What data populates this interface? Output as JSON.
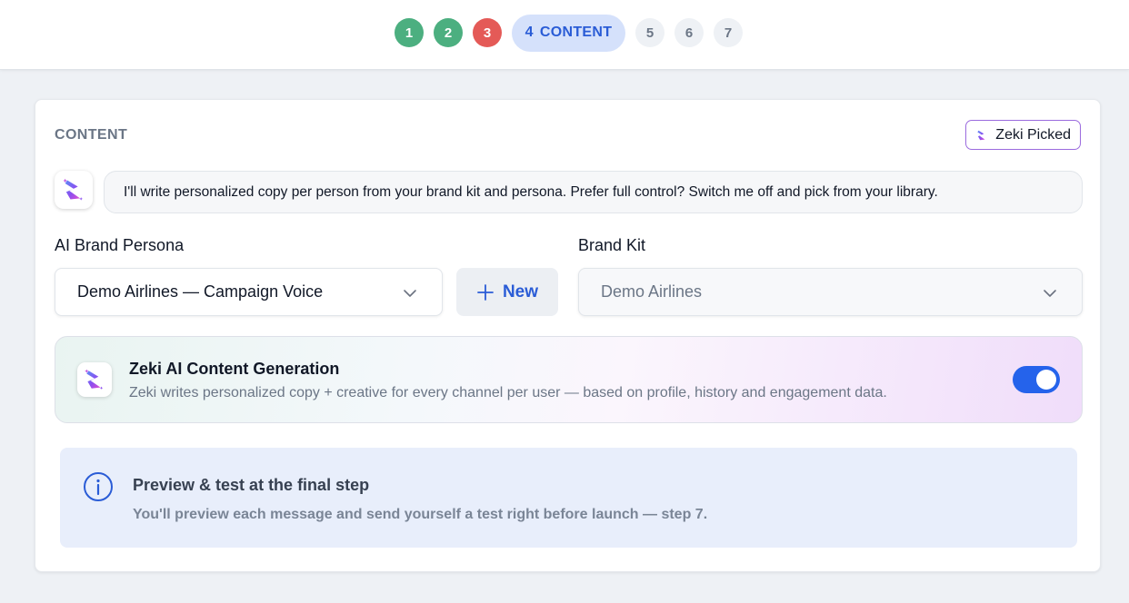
{
  "stepper": {
    "steps": [
      {
        "number": "1",
        "state": "done"
      },
      {
        "number": "2",
        "state": "done"
      },
      {
        "number": "3",
        "state": "error"
      },
      {
        "number": "4",
        "label": "CONTENT",
        "state": "active"
      },
      {
        "number": "5",
        "state": "future"
      },
      {
        "number": "6",
        "state": "future"
      },
      {
        "number": "7",
        "state": "future"
      }
    ]
  },
  "content": {
    "section_title": "CONTENT",
    "badge_label": "Zeki Picked",
    "assistant_message": "I'll write personalized copy per person from your brand kit and persona. Prefer full control? Switch me off and pick from your library.",
    "persona": {
      "label": "AI Brand Persona",
      "selected": "Demo Airlines — Campaign Voice",
      "new_button": "New"
    },
    "brand_kit": {
      "label": "Brand Kit",
      "selected": "Demo Airlines"
    },
    "generation": {
      "title": "Zeki AI Content Generation",
      "description": "Zeki writes personalized copy + creative for every channel per user — based on profile, history and engagement data.",
      "enabled": true
    },
    "info": {
      "title": "Preview & test at the final step",
      "description": "You'll preview each message and send yourself a test right before launch — step 7."
    }
  },
  "colors": {
    "accent": "#2563eb",
    "step_done": "#4caf80",
    "step_error": "#e45a57",
    "active_step_bg": "#d5e1fb",
    "badge_border": "#9b6bde"
  },
  "icons": {
    "zeki_logo": "zeki-logo-icon",
    "chevron": "chevron-down-icon",
    "plus": "plus-icon",
    "info": "info-icon"
  }
}
